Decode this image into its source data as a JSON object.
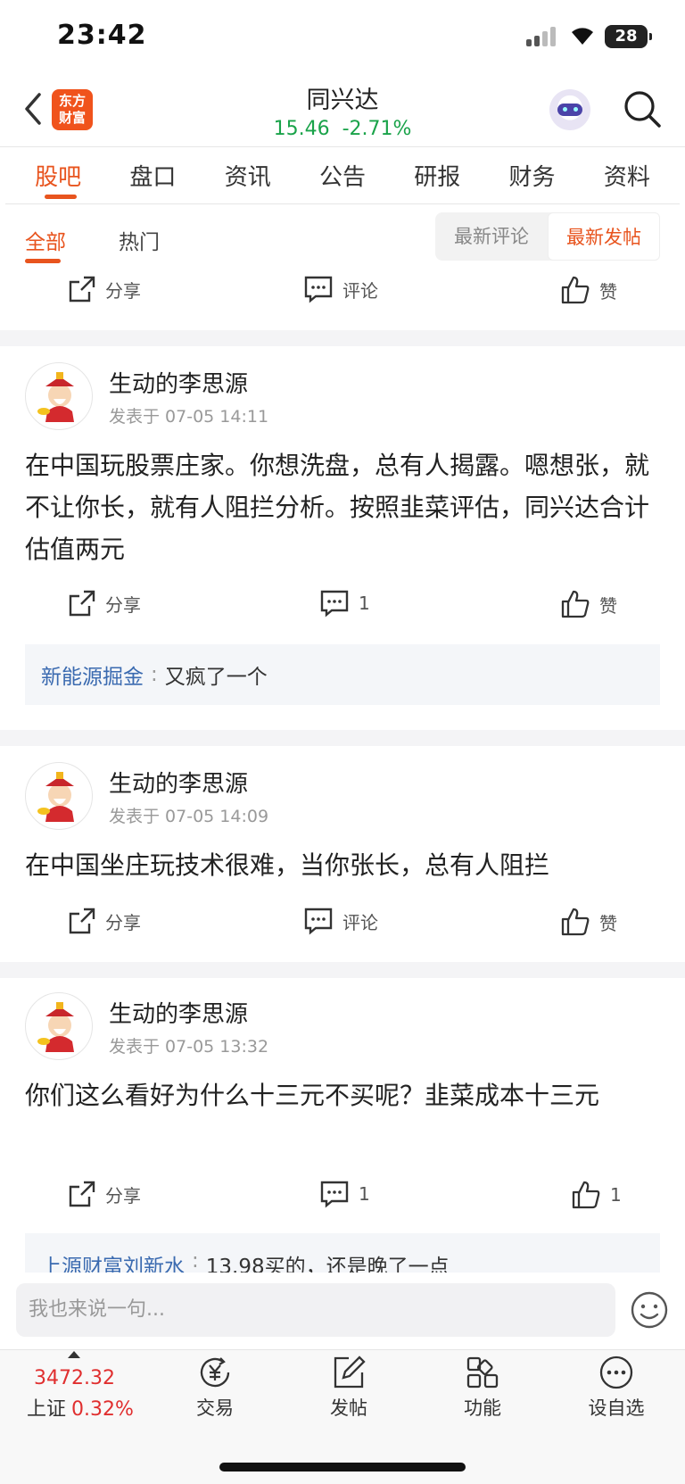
{
  "status": {
    "time": "23:42",
    "battery": "28"
  },
  "header": {
    "title": "同兴达",
    "price": "15.46",
    "change": "-2.71%",
    "logo_line1": "东方",
    "logo_line2": "财富"
  },
  "tabs": [
    "股吧",
    "盘口",
    "资讯",
    "公告",
    "研报",
    "财务",
    "资料"
  ],
  "subtabs": {
    "all": "全部",
    "hot": "热门"
  },
  "sort": {
    "latest_comment": "最新评论",
    "latest_post": "最新发帖"
  },
  "actions": {
    "share": "分享",
    "comment": "评论",
    "like": "赞"
  },
  "posts": [
    {
      "user": "生动的李思源",
      "time": "发表于 07-05 14:11",
      "text": "在中国玩股票庄家。你想洗盘，总有人揭露。嗯想张，就不让你长，就有人阻拦分析。按照韭菜评估，同兴达合计估值两元",
      "share": "分享",
      "comments": "1",
      "likes": "赞",
      "reply": {
        "user": "新能源掘金",
        "text": "又疯了一个"
      }
    },
    {
      "user": "生动的李思源",
      "time": "发表于 07-05 14:09",
      "text": "在中国坐庄玩技术很难，当你张长，总有人阻拦",
      "share": "分享",
      "comments": "评论",
      "likes": "赞"
    },
    {
      "user": "生动的李思源",
      "time": "发表于 07-05 13:32",
      "text": "你们这么看好为什么十三元不买呢？韭菜成本十三元",
      "share": "分享",
      "comments": "1",
      "likes": "1",
      "reply": {
        "user": "上源财富刘新水",
        "text": "13.98买的，还是晚了一点"
      }
    }
  ],
  "composer": {
    "placeholder": "我也来说一句..."
  },
  "bottom": {
    "index_value": "3472.32",
    "index_name": "上证",
    "index_change": "0.32%",
    "nav": [
      "交易",
      "发帖",
      "功能",
      "设自选"
    ]
  }
}
